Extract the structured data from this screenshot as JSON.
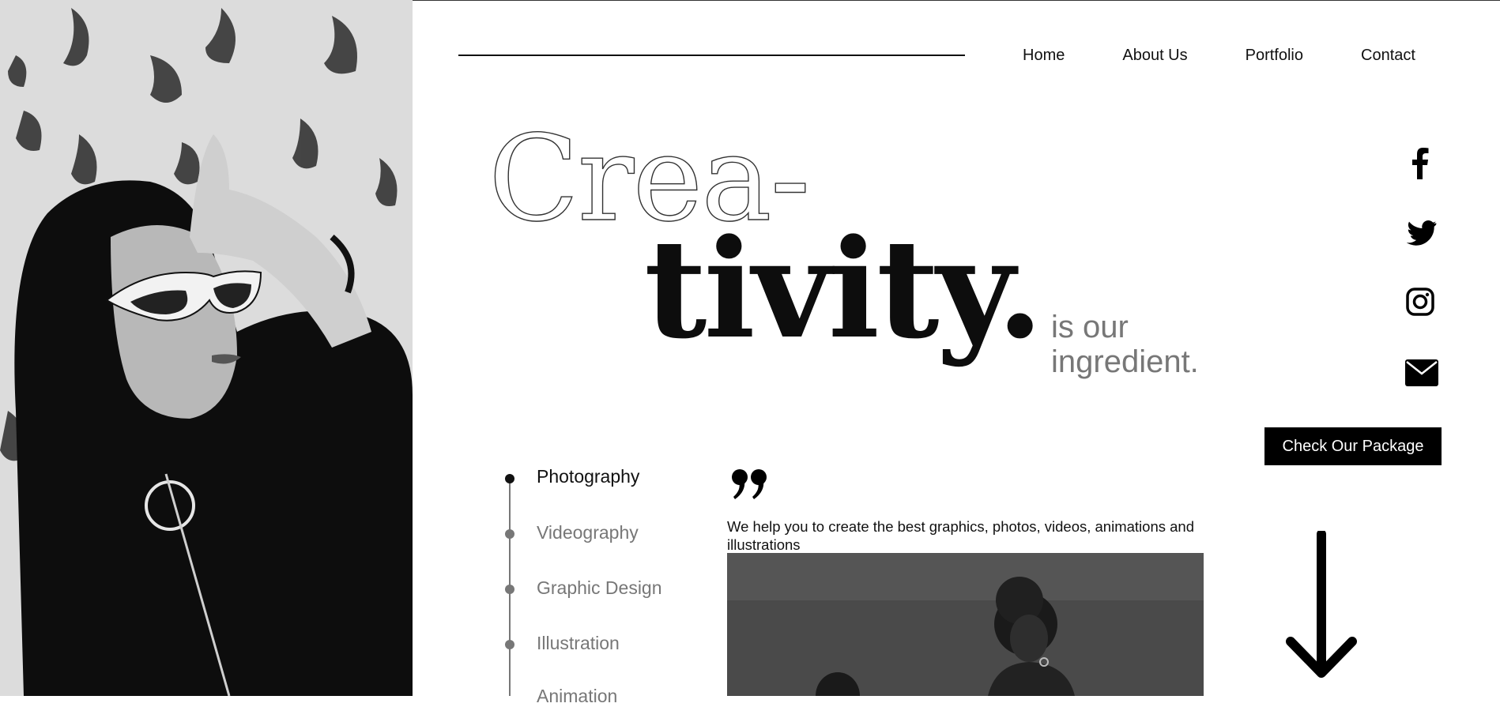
{
  "nav": {
    "items": [
      "Home",
      "About Us",
      "Portfolio",
      "Contact"
    ]
  },
  "hero": {
    "headline_line1": "Crea-",
    "headline_line2": "tivity.",
    "subline_1": "is our",
    "subline_2": "ingredient."
  },
  "social": {
    "icons": [
      "facebook-icon",
      "twitter-icon",
      "instagram-icon",
      "mail-icon"
    ]
  },
  "cta": {
    "label": "Check Our Package"
  },
  "services": {
    "items": [
      "Photography",
      "Videography",
      "Graphic Design",
      "Illustration",
      "Animation"
    ],
    "active": "Photography"
  },
  "content": {
    "tagline": "We help you to create the best graphics, photos, videos, animations and illustrations"
  },
  "colors": {
    "primary": "#000000",
    "muted": "#777777",
    "background": "#ffffff"
  }
}
